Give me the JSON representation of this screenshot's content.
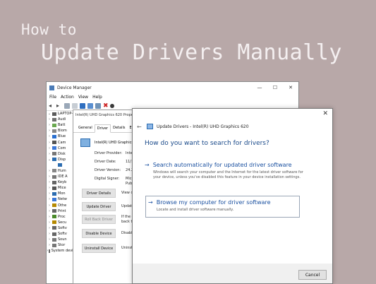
{
  "heading": {
    "line1": "How to",
    "line2": "Update Drivers Manually"
  },
  "device_manager": {
    "title": "Device Manager",
    "window_controls": [
      "—",
      "☐",
      "✕"
    ],
    "menu": [
      "File",
      "Action",
      "View",
      "Help"
    ],
    "tree_items": [
      {
        "label": "LAPTOP-",
        "expander": "⌄",
        "color": "#5b5b5b"
      },
      {
        "label": "Audi",
        "expander": "›",
        "color": "#6f6f6f"
      },
      {
        "label": "Batt",
        "expander": "›",
        "color": "#6aa84f"
      },
      {
        "label": "Biom",
        "expander": "›",
        "color": "#888888"
      },
      {
        "label": "Blue",
        "expander": "›",
        "color": "#2a6fcf"
      },
      {
        "label": "Cam",
        "expander": "›",
        "color": "#555555"
      },
      {
        "label": "Com",
        "expander": "›",
        "color": "#3c78d8"
      },
      {
        "label": "Disk",
        "expander": "›",
        "color": "#777777"
      },
      {
        "label": "Disp",
        "expander": "⌄",
        "color": "#2b6cb0"
      },
      {
        "label": "",
        "expander": "",
        "color": "#2b6cb0"
      },
      {
        "label": "Hum",
        "expander": "›",
        "color": "#888888"
      },
      {
        "label": "IDE A",
        "expander": "›",
        "color": "#777777"
      },
      {
        "label": "Keyb",
        "expander": "›",
        "color": "#666666"
      },
      {
        "label": "Mice",
        "expander": "›",
        "color": "#555555"
      },
      {
        "label": "Mon",
        "expander": "›",
        "color": "#2b6cb0"
      },
      {
        "label": "Netw",
        "expander": "›",
        "color": "#3c78d8"
      },
      {
        "label": "Othe",
        "expander": "›",
        "color": "#b58900"
      },
      {
        "label": "Print",
        "expander": "›",
        "color": "#666666"
      },
      {
        "label": "Proc",
        "expander": "›",
        "color": "#4a8a2a"
      },
      {
        "label": "Secu",
        "expander": "›",
        "color": "#b58900"
      },
      {
        "label": "Softv",
        "expander": "›",
        "color": "#666666"
      },
      {
        "label": "Softv",
        "expander": "›",
        "color": "#666666"
      },
      {
        "label": "Soun",
        "expander": "›",
        "color": "#777777"
      },
      {
        "label": "Stor",
        "expander": "›",
        "color": "#777777"
      },
      {
        "label": "System devices",
        "expander": "›",
        "color": "#666666"
      }
    ]
  },
  "properties": {
    "title": "Intel(R) UHD Graphics 620 Prope",
    "tabs": [
      "General",
      "Driver",
      "Details",
      "Events"
    ],
    "active_tab": "Driver",
    "device_name": "Intel(R) UHD Graphics 6",
    "fields": [
      {
        "label": "Driver Provider:",
        "value": "Intel"
      },
      {
        "label": "Driver Date:",
        "value": "11/1"
      },
      {
        "label": "Driver Version:",
        "value": "24.2"
      },
      {
        "label": "Digital Signer:",
        "value": "Micr"
      },
      {
        "label": "",
        "value": "Publ"
      }
    ],
    "buttons": [
      {
        "label": "Driver Details",
        "desc": "View d"
      },
      {
        "label": "Update Driver",
        "desc": "Update"
      },
      {
        "label": "Roll Back Driver",
        "desc": "If the d"
      },
      {
        "label": "",
        "desc": "back to"
      },
      {
        "label": "Disable Device",
        "desc": "Disable"
      },
      {
        "label": "Uninstall Device",
        "desc": "Uninsta"
      }
    ]
  },
  "update_dialog": {
    "close": "✕",
    "back": "←",
    "header": "Update Drivers - Intel(R) UHD Graphics 620",
    "question": "How do you want to search for drivers?",
    "options": [
      {
        "title": "Search automatically for updated driver software",
        "desc": [
          "Windows will search your computer and the Internet for the latest driver software for",
          "your device, unless you've disabled this feature in your device installation settings."
        ]
      },
      {
        "title": "Browse my computer for driver software",
        "desc": [
          "Locate and install driver software manually."
        ]
      }
    ],
    "cancel": "Cancel"
  },
  "colors": {
    "background": "#b8a8a8",
    "title_text": "#f4eff0",
    "link_blue": "#1a50a0",
    "question_blue": "#1a4a8a"
  }
}
